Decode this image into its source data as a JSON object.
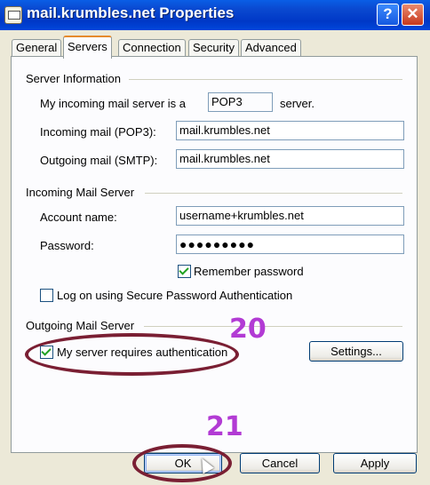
{
  "window": {
    "title": "mail.krumbles.net Properties",
    "help_label": "?",
    "close_label": "✕"
  },
  "tabs": [
    {
      "label": "General"
    },
    {
      "label": "Servers",
      "active": true
    },
    {
      "label": "Connection"
    },
    {
      "label": "Security"
    },
    {
      "label": "Advanced"
    }
  ],
  "server_info": {
    "title": "Server Information",
    "incoming_type_prefix": "My incoming mail server is a",
    "incoming_type_value": "POP3",
    "incoming_type_suffix": "server.",
    "incoming_label": "Incoming mail (POP3):",
    "incoming_value": "mail.krumbles.net",
    "outgoing_label": "Outgoing mail (SMTP):",
    "outgoing_value": "mail.krumbles.net"
  },
  "incoming_server": {
    "title": "Incoming Mail Server",
    "account_label": "Account name:",
    "account_value": "username+krumbles.net",
    "password_label": "Password:",
    "password_value": "●●●●●●●●●",
    "remember_label": "Remember password",
    "remember_checked": true,
    "spa_label": "Log on using Secure Password Authentication",
    "spa_checked": false
  },
  "outgoing_server": {
    "title": "Outgoing Mail Server",
    "auth_label": "My server requires authentication",
    "auth_checked": true,
    "settings_label": "Settings..."
  },
  "buttons": {
    "ok": "OK",
    "cancel": "Cancel",
    "apply": "Apply"
  },
  "annotations": {
    "step_20": "20",
    "step_21": "21",
    "highlight_color": "#7a1f33",
    "number_color": "#b23bd4"
  }
}
